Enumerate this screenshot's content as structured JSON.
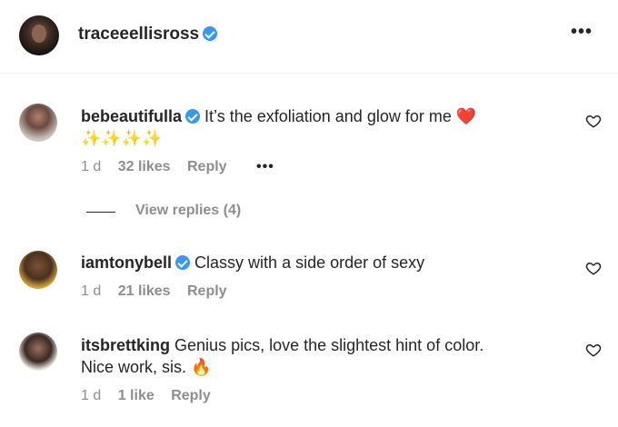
{
  "header": {
    "username": "traceeellisross",
    "more_icon": "more-horizontal-icon"
  },
  "comments": [
    {
      "username": "bebeautifulla",
      "verified": true,
      "text": "It’s the exfoliation and glow for me",
      "text_emoji": "❤️",
      "second_line": "✨✨✨✨",
      "time": "1 d",
      "likes": "32 likes",
      "reply": "Reply",
      "more": "•••",
      "view_replies": "View replies (4)"
    },
    {
      "username": "iamtonybell",
      "verified": true,
      "text": "Classy with a side order of sexy",
      "time": "1 d",
      "likes": "21 likes",
      "reply": "Reply"
    },
    {
      "username": "itsbrettking",
      "verified": false,
      "text": "Genius pics, love the slightest hint of color.",
      "second_line": "Nice work, sis. 🔥",
      "time": "1 d",
      "likes": "1 like",
      "reply": "Reply"
    }
  ],
  "colors": {
    "primary_text": "#262626",
    "secondary_text": "#8e8e8e",
    "verified_badge": "#3897f0",
    "divider": "#efefef"
  }
}
